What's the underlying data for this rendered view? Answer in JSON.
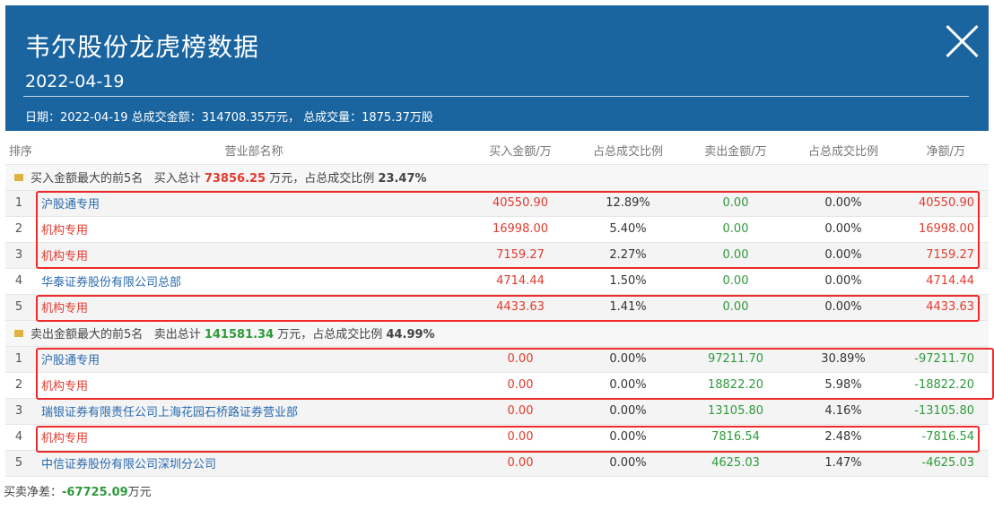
{
  "header": {
    "title": "韦尔股份龙虎榜数据",
    "date": "2022-04-19",
    "info": "日期：2022-04-19 总成交金额：314708.35万元，  总成交量：1875.37万股"
  },
  "table": {
    "headers": {
      "rank": "排序",
      "name": "营业部名称",
      "buy": "买入金额/万",
      "buy_ratio": "占总成交比例",
      "sell": "卖出金额/万",
      "sell_ratio": "占总成交比例",
      "net": "净额/万"
    },
    "buy_section": {
      "label": "买入金额最大的前5名",
      "total_label": "买入总计",
      "total": "73856.25",
      "unit_text": "万元，占总成交比例",
      "ratio": "23.47%"
    },
    "buy_rows": [
      {
        "rank": "1",
        "name": "沪股通专用",
        "buy": "40550.90",
        "buy_ratio": "12.89%",
        "sell": "0.00",
        "sell_ratio": "0.00%",
        "net": "40550.90"
      },
      {
        "rank": "2",
        "name": "机构专用",
        "buy": "16998.00",
        "buy_ratio": "5.40%",
        "sell": "0.00",
        "sell_ratio": "0.00%",
        "net": "16998.00"
      },
      {
        "rank": "3",
        "name": "机构专用",
        "buy": "7159.27",
        "buy_ratio": "2.27%",
        "sell": "0.00",
        "sell_ratio": "0.00%",
        "net": "7159.27"
      },
      {
        "rank": "4",
        "name": "华泰证券股份有限公司总部",
        "buy": "4714.44",
        "buy_ratio": "1.50%",
        "sell": "0.00",
        "sell_ratio": "0.00%",
        "net": "4714.44"
      },
      {
        "rank": "5",
        "name": "机构专用",
        "buy": "4433.63",
        "buy_ratio": "1.41%",
        "sell": "0.00",
        "sell_ratio": "0.00%",
        "net": "4433.63"
      }
    ],
    "sell_section": {
      "label": "卖出金额最大的前5名",
      "total_label": "卖出总计",
      "total": "141581.34",
      "unit_text": "万元，占总成交比例",
      "ratio": "44.99%"
    },
    "sell_rows": [
      {
        "rank": "1",
        "name": "沪股通专用",
        "buy": "0.00",
        "buy_ratio": "0.00%",
        "sell": "97211.70",
        "sell_ratio": "30.89%",
        "net": "-97211.70"
      },
      {
        "rank": "2",
        "name": "机构专用",
        "buy": "0.00",
        "buy_ratio": "0.00%",
        "sell": "18822.20",
        "sell_ratio": "5.98%",
        "net": "-18822.20"
      },
      {
        "rank": "3",
        "name": "瑞银证券有限责任公司上海花园石桥路证券营业部",
        "buy": "0.00",
        "buy_ratio": "0.00%",
        "sell": "13105.80",
        "sell_ratio": "4.16%",
        "net": "-13105.80"
      },
      {
        "rank": "4",
        "name": "机构专用",
        "buy": "0.00",
        "buy_ratio": "0.00%",
        "sell": "7816.54",
        "sell_ratio": "2.48%",
        "net": "-7816.54"
      },
      {
        "rank": "5",
        "name": "中信证券股份有限公司深圳分公司",
        "buy": "0.00",
        "buy_ratio": "0.00%",
        "sell": "4625.03",
        "sell_ratio": "1.47%",
        "net": "-4625.03"
      }
    ]
  },
  "footer": {
    "label": "买卖净差：",
    "value": "-67725.09",
    "unit": "万元"
  },
  "colors": {
    "header_bg": "#1a64a0",
    "buy_red": "#e23b2e",
    "sell_green": "#2f9a3c",
    "link_blue": "#2a6aae",
    "highlight_red": "#ee2a2a"
  },
  "icons": {
    "close": "close-icon",
    "section": "folder-icon"
  }
}
